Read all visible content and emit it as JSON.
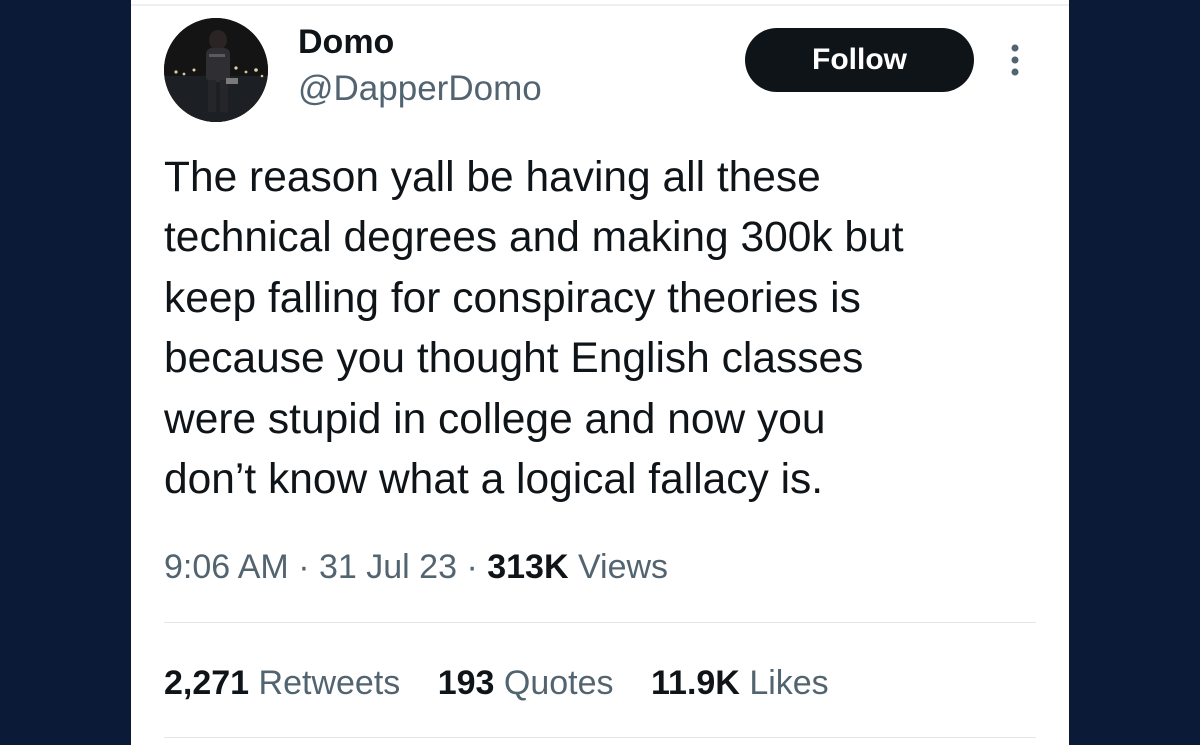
{
  "tweet": {
    "author": {
      "name": "Domo",
      "handle": "@DapperDomo"
    },
    "follow_label": "Follow",
    "text": "The reason yall be having all these\ntechnical degrees and making 300k but\nkeep falling for conspiracy theories is\nbecause you thought English classes\nwere stupid in college and now you\ndon’t know what a logical fallacy is.",
    "time": "9:06 AM",
    "date": "31 Jul 23",
    "separator": "·",
    "views_count": "313K",
    "views_label": "Views",
    "stats": [
      {
        "count": "2,271",
        "label": "Retweets"
      },
      {
        "count": "193",
        "label": "Quotes"
      },
      {
        "count": "11.9K",
        "label": "Likes"
      }
    ]
  },
  "icons": {
    "more": "more-vertical-icon",
    "avatar": "profile-avatar"
  },
  "colors": {
    "background": "#0b1a36",
    "card": "#ffffff",
    "text_primary": "#0f1419",
    "text_secondary": "#536471",
    "follow_button": "#0f1419"
  }
}
